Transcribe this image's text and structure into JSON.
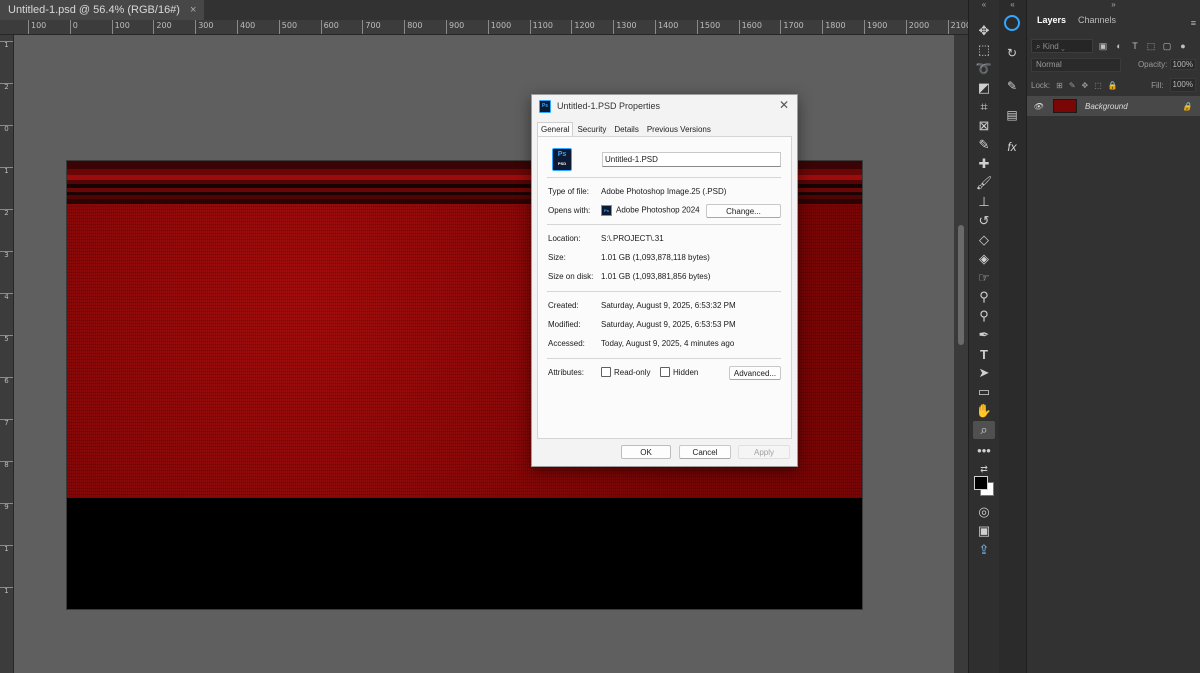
{
  "document": {
    "tab_title": "Untitled-1.psd @ 56.4% (RGB/16#)",
    "close_glyph": "×"
  },
  "ruler": {
    "h_labels": [
      "100",
      "0",
      "100",
      "200",
      "300",
      "400",
      "500",
      "600",
      "700",
      "800",
      "900",
      "1000",
      "1100",
      "1200",
      "1300",
      "1400",
      "1500",
      "1600",
      "1700",
      "1800",
      "1900",
      "2000",
      "2100"
    ],
    "v_labels": [
      "1",
      "2",
      "0",
      "1",
      "2",
      "3",
      "4",
      "5",
      "6",
      "7",
      "8",
      "9",
      "1",
      "1"
    ]
  },
  "toolbar": {
    "collapse": "«",
    "tools": [
      "move-tool",
      "artboard-tool",
      "marquee-tool",
      "lasso-tool",
      "object-select-tool",
      "crop-tool",
      "frame-tool",
      "eyedropper-tool",
      "spot-healing-tool",
      "brush-tool",
      "clone-stamp-tool",
      "history-brush-tool",
      "eraser-tool",
      "paint-bucket-tool",
      "smudge-tool",
      "dodge-tool",
      "pen-tool",
      "type-tool",
      "path-select-tool",
      "rectangle-tool",
      "hand-tool",
      "zoom-tool",
      "more-tools"
    ]
  },
  "sidebar": {
    "collapse": "«"
  },
  "layers_panel": {
    "collapse": "»",
    "tabs": [
      "Layers",
      "Channels"
    ],
    "active_tab": "Layers",
    "menu_glyph": "≡",
    "kind_filter": "Kind",
    "blend_mode": "Normal",
    "opacity_label": "Opacity:",
    "opacity_value": "100%",
    "lock_label": "Lock:",
    "fill_label": "Fill:",
    "fill_value": "100%",
    "layers": [
      {
        "name": "Background",
        "visible": true,
        "locked": true
      }
    ]
  },
  "dialog": {
    "title": "Untitled-1.PSD Properties",
    "close": "✕",
    "tabs": [
      "General",
      "Security",
      "Details",
      "Previous Versions"
    ],
    "active_tab": "General",
    "icon_label": "Ps",
    "icon_sub": "PSD",
    "file_name": "Untitled-1.PSD",
    "type_label": "Type of file:",
    "type_value": "Adobe Photoshop Image.25 (.PSD)",
    "opens_label": "Opens with:",
    "opens_value": "Adobe Photoshop 2024",
    "change_button": "Change...",
    "location_label": "Location:",
    "location_value": "S:\\.PROJECT\\.31",
    "size_label": "Size:",
    "size_value": "1.01 GB (1,093,878,118 bytes)",
    "size_disk_label": "Size on disk:",
    "size_disk_value": "1.01 GB (1,093,881,856 bytes)",
    "created_label": "Created:",
    "created_value": "Saturday, August 9, 2025, 6:53:32 PM",
    "modified_label": "Modified:",
    "modified_value": "Saturday, August 9, 2025, 6:53:53 PM",
    "accessed_label": "Accessed:",
    "accessed_value": "Today, August 9, 2025, 4 minutes ago",
    "attributes_label": "Attributes:",
    "readonly_label": "Read-only",
    "hidden_label": "Hidden",
    "readonly_checked": false,
    "hidden_checked": false,
    "advanced_button": "Advanced...",
    "ok_button": "OK",
    "cancel_button": "Cancel",
    "apply_button": "Apply"
  },
  "colors": {
    "canvas_red": "#8c0808",
    "ps_blue": "#31a8ff",
    "foreground": "#000000",
    "background": "#ffffff"
  }
}
